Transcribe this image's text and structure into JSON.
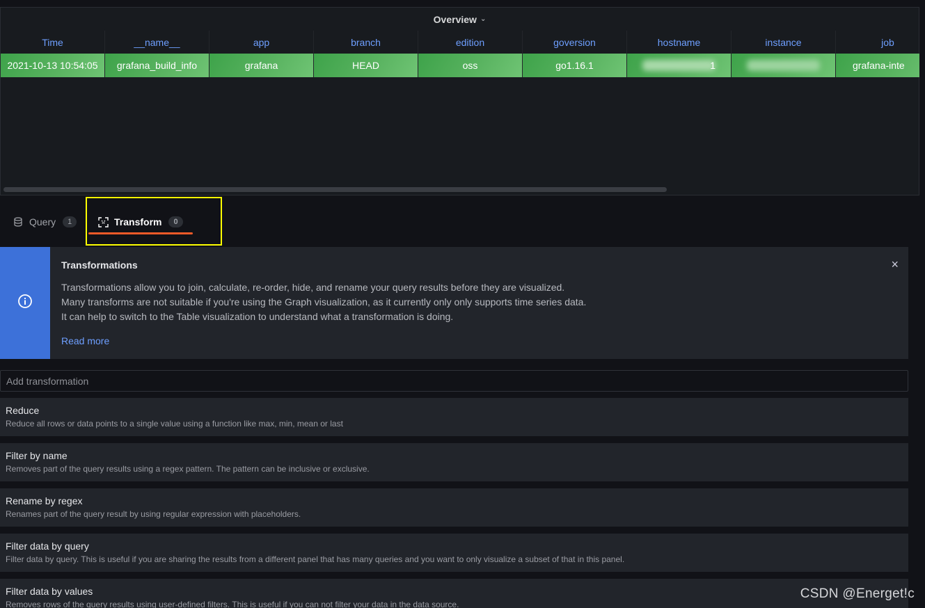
{
  "panel": {
    "title": "Overview",
    "table": {
      "columns": [
        "Time",
        "__name__",
        "app",
        "branch",
        "edition",
        "goversion",
        "hostname",
        "instance",
        "job"
      ],
      "row": [
        "2021-10-13 10:54:05",
        "grafana_build_info",
        "grafana",
        "HEAD",
        "oss",
        "go1.16.1",
        "1",
        "",
        "grafana-inte"
      ]
    },
    "row_color": "#56b05c"
  },
  "tabs": [
    {
      "label": "Query",
      "count": "1",
      "icon": "database-icon",
      "active": false
    },
    {
      "label": "Transform",
      "count": "0",
      "icon": "transform-icon",
      "active": true
    }
  ],
  "alert": {
    "title": "Transformations",
    "lines": [
      "Transformations allow you to join, calculate, re-order, hide, and rename your query results before they are visualized.",
      "Many transforms are not suitable if you're using the Graph visualization, as it currently only only supports time series data.",
      "It can help to switch to the Table visualization to understand what a transformation is doing."
    ],
    "link": "Read more",
    "accent_color": "#3d71d9",
    "close_symbol": "×"
  },
  "add_transformation": {
    "placeholder": "Add transformation"
  },
  "transformations": [
    {
      "title": "Reduce",
      "description": "Reduce all rows or data points to a single value using a function like max, min, mean or last"
    },
    {
      "title": "Filter by name",
      "description": "Removes part of the query results using a regex pattern. The pattern can be inclusive or exclusive."
    },
    {
      "title": "Rename by regex",
      "description": "Renames part of the query result by using regular expression with placeholders."
    },
    {
      "title": "Filter data by query",
      "description": "Filter data by query. This is useful if you are sharing the results from a different panel that has many queries and you want to only visualize a subset of that in this panel."
    },
    {
      "title": "Filter data by values",
      "description": "Removes rows of the query results using user-defined filters. This is useful if you can not filter your data in the data source."
    }
  ],
  "watermark": "CSDN @Energet!c"
}
